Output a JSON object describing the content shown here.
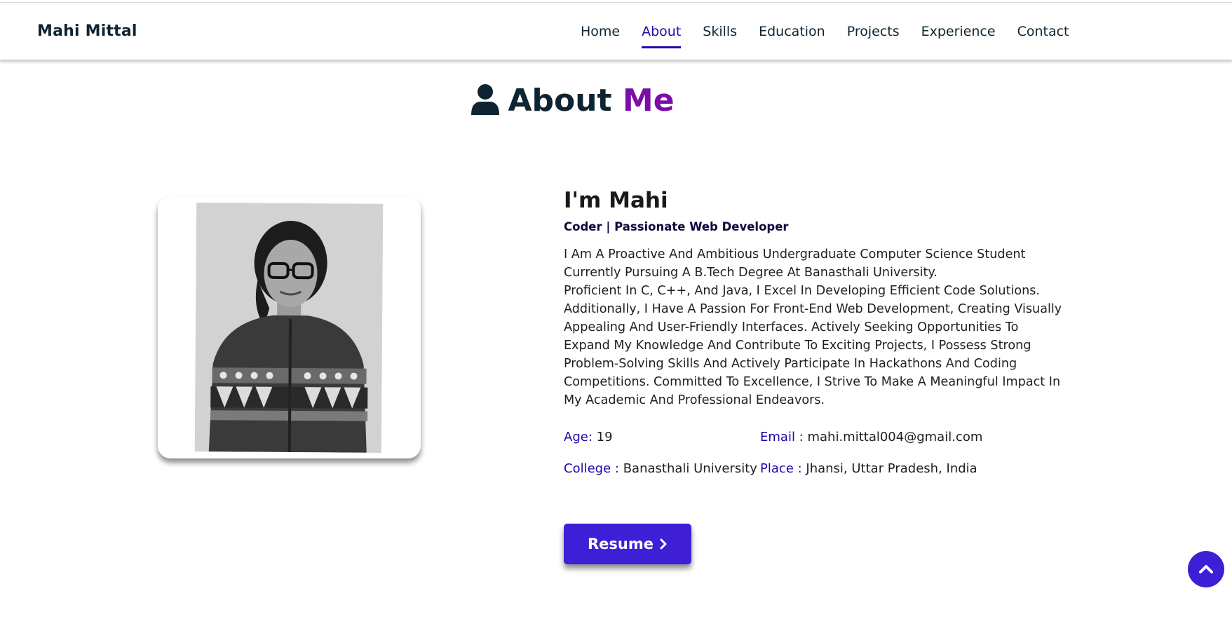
{
  "header": {
    "brand": "Mahi Mittal",
    "nav": [
      {
        "label": "Home",
        "active": false
      },
      {
        "label": "About",
        "active": true
      },
      {
        "label": "Skills",
        "active": false
      },
      {
        "label": "Education",
        "active": false
      },
      {
        "label": "Projects",
        "active": false
      },
      {
        "label": "Experience",
        "active": false
      },
      {
        "label": "Contact",
        "active": false
      }
    ]
  },
  "section": {
    "icon": "user-icon",
    "title_prefix": "About",
    "title_accent": "Me"
  },
  "about": {
    "name": "I'm Mahi",
    "tagline": "Coder | Passionate Web Developer",
    "bio_line1": "I Am A Proactive And Ambitious Undergraduate Computer Science Student Currently Pursuing A B.Tech Degree At Banasthali University.",
    "bio_line2": "Proficient In C, C++, And Java, I Excel In Developing Efficient Code Solutions. Additionally, I Have A Passion For Front-End Web Development, Creating Visually Appealing And User-Friendly Interfaces. Actively Seeking Opportunities To Expand My Knowledge And Contribute To Exciting Projects, I Possess Strong Problem-Solving Skills And Actively Participate In Hackathons And Coding Competitions. Committed To Excellence, I Strive To Make A Meaningful Impact In My Academic And Professional Endeavors.",
    "age_label": "Age:",
    "age_value": "19",
    "email_label": "Email :",
    "email_value": "mahi.mittal004@gmail.com",
    "college_label": "College :",
    "college_value": "Banasthali University",
    "place_label": "Place :",
    "place_value": "Jhansi, Uttar Pradesh, India",
    "resume_label": "Resume"
  },
  "colors": {
    "accent_blue": "#2506ad",
    "accent_purple": "#7b0ea8",
    "button": "#3f1fd6"
  },
  "icons": {
    "resume": "chevron-right-icon",
    "scroll_top": "chevron-up-icon"
  }
}
